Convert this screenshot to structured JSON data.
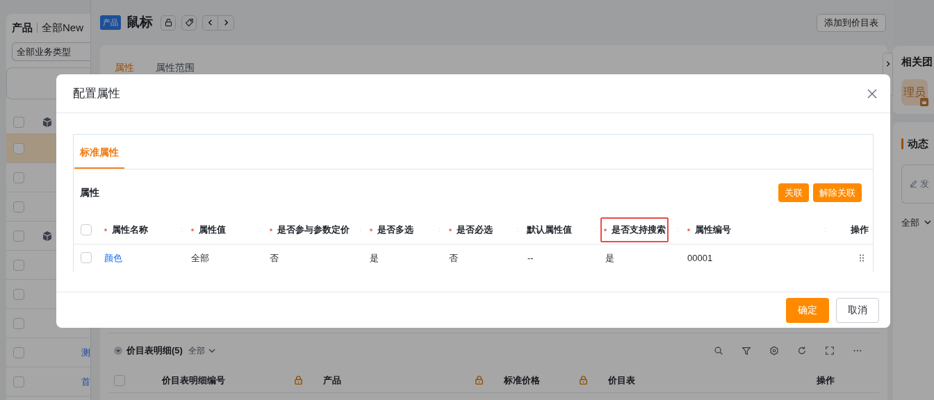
{
  "sidebar": {
    "title": "产品",
    "view": "全部New",
    "filter": "全部业务类型",
    "all_checked": false,
    "rows": [
      {
        "kind": "item",
        "selected": true
      },
      {
        "kind": "item",
        "selected": false
      },
      {
        "kind": "item",
        "selected": false
      },
      {
        "kind": "group",
        "selected": false
      },
      {
        "kind": "item",
        "selected": false
      },
      {
        "kind": "item",
        "selected": false
      },
      {
        "kind": "item",
        "selected": false
      },
      {
        "kind": "item",
        "selected": false,
        "name": "测"
      },
      {
        "kind": "item",
        "selected": false,
        "name": "首"
      }
    ]
  },
  "detail": {
    "badge": "产品",
    "title": "鼠标",
    "action": "添加到价目表",
    "tabs": [
      {
        "label": "属性",
        "selected": true
      },
      {
        "label": "属性范围",
        "selected": false
      }
    ],
    "price_list": {
      "title": "价目表明细(5)",
      "filter": "全部",
      "all_checked": false,
      "columns": [
        {
          "label": "价目表明细编号",
          "locked": true
        },
        {
          "label": "产品",
          "locked": true
        },
        {
          "label": "标准价格",
          "locked": true
        },
        {
          "label": "价目表",
          "locked": false
        },
        {
          "label": "操作",
          "locked": false
        }
      ]
    }
  },
  "right_panel": {
    "team_title": "相关团",
    "member": "理员",
    "activity_title": "动态",
    "composer_placeholder": "发",
    "filter": "全部"
  },
  "dialog": {
    "title": "配置属性",
    "tabs": [
      {
        "label": "标准属性",
        "selected": true
      }
    ],
    "section_title": "属性",
    "all_checked": false,
    "buttons": [
      "关联",
      "解除关联"
    ],
    "columns": [
      {
        "label": "属性名称",
        "required": true,
        "highlighted": false
      },
      {
        "label": "属性值",
        "required": true,
        "highlighted": false
      },
      {
        "label": "是否参与参数定价",
        "required": true,
        "highlighted": false
      },
      {
        "label": "是否多选",
        "required": true,
        "highlighted": false
      },
      {
        "label": "是否必选",
        "required": true,
        "highlighted": false
      },
      {
        "label": "默认属性值",
        "required": false,
        "highlighted": false
      },
      {
        "label": "是否支持搜索",
        "required": true,
        "highlighted": true
      },
      {
        "label": "属性编号",
        "required": true,
        "highlighted": false
      },
      {
        "label": "操作",
        "required": false,
        "highlighted": false
      }
    ],
    "rows": [
      {
        "checked": false,
        "cells": [
          "颜色",
          "全部",
          "否",
          "是",
          "否",
          "--",
          "是",
          "00001"
        ]
      }
    ],
    "footer_buttons": [
      {
        "label": "确定",
        "primary": true
      },
      {
        "label": "取消",
        "primary": false
      }
    ]
  }
}
